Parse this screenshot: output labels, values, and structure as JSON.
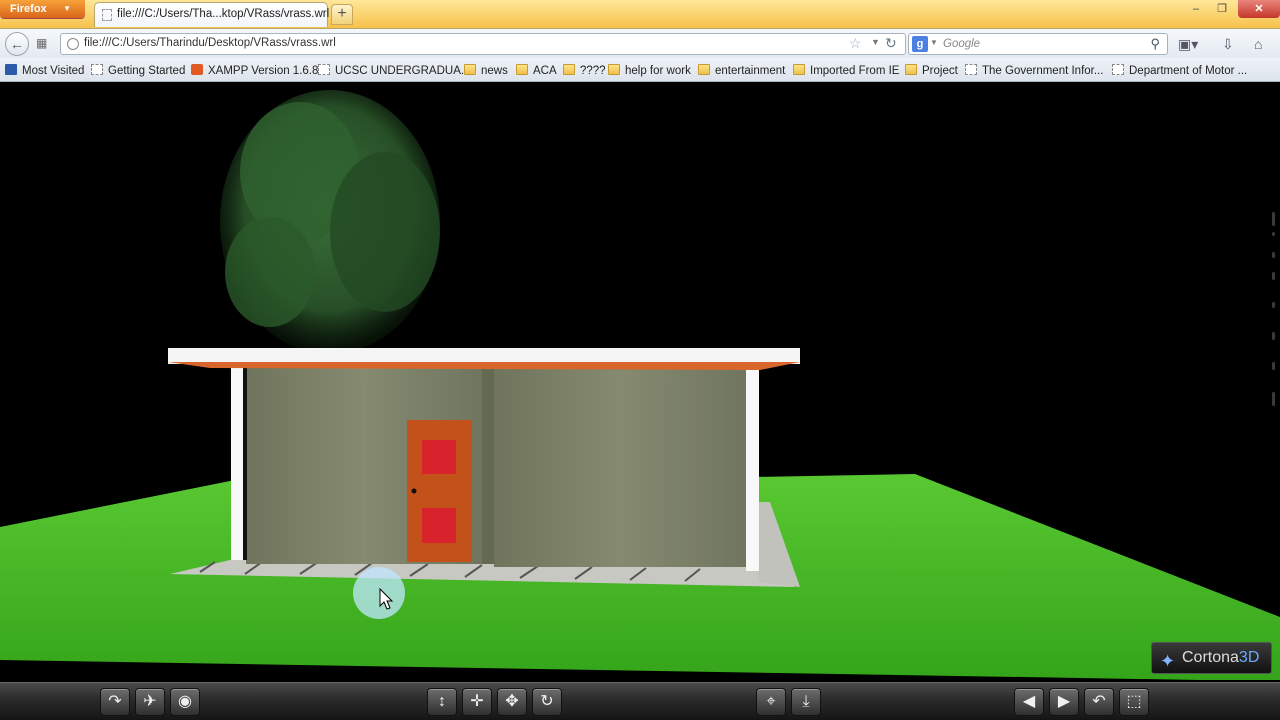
{
  "browser": {
    "menu_label": "Firefox",
    "tab_title": "file:///C:/Users/Tha...ktop/VRass/vrass.wrl",
    "new_tab_label": "+",
    "url": "file:///C:/Users/Tharindu/Desktop/VRass/vrass.wrl",
    "search_placeholder": "Google",
    "window_controls": {
      "minimize": "–",
      "restore": "❐",
      "close": "✕"
    }
  },
  "bookmarks": [
    {
      "label": "Most Visited",
      "icon": "blue"
    },
    {
      "label": "Getting Started",
      "icon": "page"
    },
    {
      "label": "XAMPP Version 1.6.8",
      "icon": "xampp"
    },
    {
      "label": "UCSC UNDERGRADUA...",
      "icon": "page"
    },
    {
      "label": "news",
      "icon": "folder"
    },
    {
      "label": "ACA",
      "icon": "folder"
    },
    {
      "label": "????",
      "icon": "folder"
    },
    {
      "label": "help for work",
      "icon": "folder"
    },
    {
      "label": "entertainment",
      "icon": "folder"
    },
    {
      "label": "Imported From IE",
      "icon": "folder"
    },
    {
      "label": "Project",
      "icon": "folder"
    },
    {
      "label": "The Government Infor...",
      "icon": "page"
    },
    {
      "label": "Department of Motor ...",
      "icon": "page"
    }
  ],
  "viewer": {
    "logo_text": "Cortona",
    "logo_suffix": "3D",
    "colors": {
      "grass": "#3fb820",
      "wall": "#7a8066",
      "roof": "#f7f7f7",
      "roof_edge": "#d8662a",
      "door": "#c2511a",
      "door_panel": "#d8222c",
      "tree": "#2c5e2c"
    },
    "toolbar_buttons": [
      {
        "name": "walk-button",
        "icon": "walk-icon",
        "glyph": "↷"
      },
      {
        "name": "fly-button",
        "icon": "fly-icon",
        "glyph": "✈"
      },
      {
        "name": "study-button",
        "icon": "eye-icon",
        "glyph": "◉"
      },
      {
        "name": "plan-button",
        "icon": "plan-arrows-icon",
        "glyph": "↕"
      },
      {
        "name": "pan-button",
        "icon": "pan-cross-icon",
        "glyph": "✛"
      },
      {
        "name": "turn-button",
        "icon": "turn-icon",
        "glyph": "✥"
      },
      {
        "name": "roll-button",
        "icon": "roll-icon",
        "glyph": "↻"
      },
      {
        "name": "goto-button",
        "icon": "target-icon",
        "glyph": "⌖"
      },
      {
        "name": "align-button",
        "icon": "align-icon",
        "glyph": "⤓"
      },
      {
        "name": "prev-viewpoint-button",
        "icon": "triangle-left-icon",
        "glyph": "◀"
      },
      {
        "name": "next-viewpoint-button",
        "icon": "triangle-right-icon",
        "glyph": "▶"
      },
      {
        "name": "restore-button",
        "icon": "undo-icon",
        "glyph": "↶"
      },
      {
        "name": "fit-button",
        "icon": "fit-icon",
        "glyph": "⬚"
      }
    ]
  }
}
